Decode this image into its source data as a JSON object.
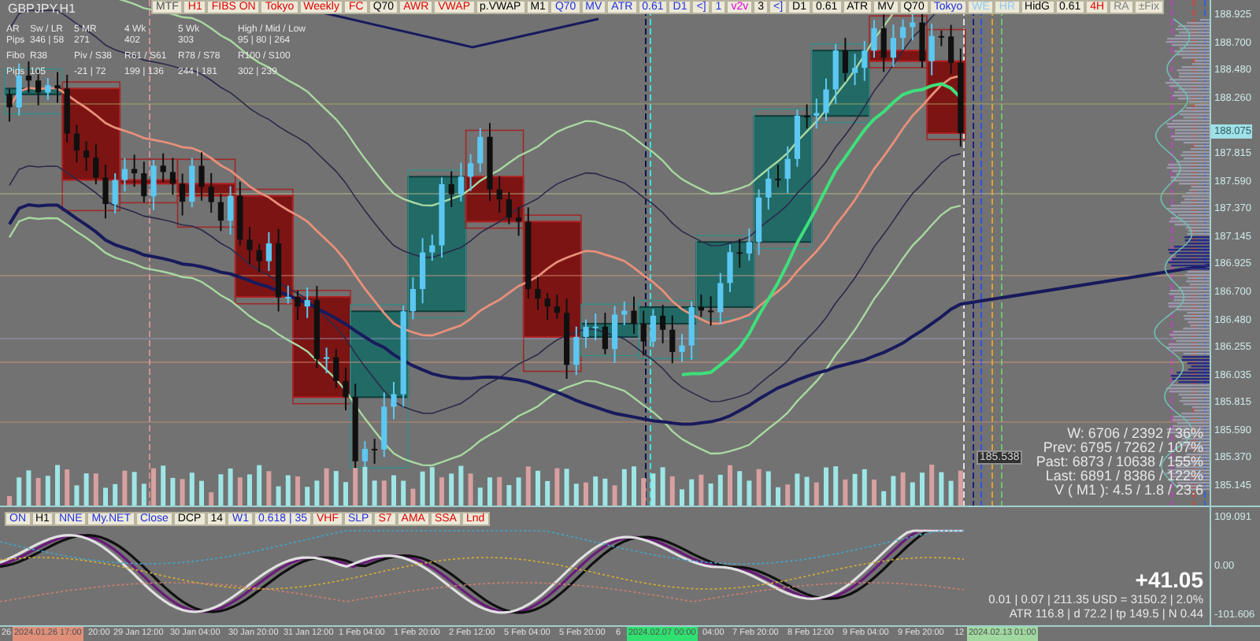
{
  "chart_title": "GBPJPY,H1",
  "top_toolbar": [
    {
      "label": "MTF",
      "color": "#505050"
    },
    {
      "label": "H1",
      "color": "#e00000"
    },
    {
      "label": "FIBS ON",
      "color": "#e00000"
    },
    {
      "label": "Tokyo",
      "color": "#e00000"
    },
    {
      "label": "Weekly",
      "color": "#e00000"
    },
    {
      "label": "FC",
      "color": "#e00000"
    },
    {
      "label": "Q70",
      "color": "#000000"
    },
    {
      "label": "AWR",
      "color": "#e00000"
    },
    {
      "label": "VWAP",
      "color": "#e00000"
    },
    {
      "label": "p.VWAP",
      "color": "#000000"
    },
    {
      "label": "M1",
      "color": "#000000"
    },
    {
      "label": "Q70",
      "color": "#2030e0"
    },
    {
      "label": "MV",
      "color": "#2030e0"
    },
    {
      "label": "ATR",
      "color": "#2030e0"
    },
    {
      "label": "0.61",
      "color": "#2030e0"
    },
    {
      "label": "D1",
      "color": "#2030e0"
    },
    {
      "label": "<]",
      "color": "#2030e0"
    },
    {
      "label": "1",
      "color": "#2030e0"
    },
    {
      "label": "v2v",
      "color": "#e000e0"
    },
    {
      "label": "3",
      "color": "#000000"
    },
    {
      "label": "<]",
      "color": "#2030e0"
    },
    {
      "label": "D1",
      "color": "#000000"
    },
    {
      "label": "0.61",
      "color": "#000000"
    },
    {
      "label": "ATR",
      "color": "#000000"
    },
    {
      "label": "MV",
      "color": "#000000"
    },
    {
      "label": "Q70",
      "color": "#000000"
    },
    {
      "label": "Tokyo",
      "color": "#2030e0"
    },
    {
      "label": "WE",
      "color": "#90c8f0"
    },
    {
      "label": "HR",
      "color": "#90c8f0"
    },
    {
      "label": "HidG",
      "color": "#000000"
    },
    {
      "label": "0.61",
      "color": "#000000"
    },
    {
      "label": "4H",
      "color": "#e00000"
    },
    {
      "label": "RA",
      "color": "#808080"
    },
    {
      "label": "±Fix",
      "color": "#808080"
    }
  ],
  "info_panel": [
    [
      "AR",
      "Sw / LR",
      "5 MR",
      "4 Wk",
      "5 Wk",
      "High / Mid / Low"
    ],
    [
      "Pips",
      "346 | 58",
      "271",
      "402",
      "303",
      "95 | 80 | 264"
    ],
    [
      "Fibo",
      "R38",
      "Piv / S38",
      "R61 / S61",
      "R78 / S78",
      "R100 / S100"
    ],
    [
      "Pips",
      "105",
      "-21 | 72",
      "199 | 136",
      "244 | 181",
      "302 | 239"
    ]
  ],
  "price_axis": [
    "188.925",
    "188.700",
    "188.480",
    "188.260",
    "187.815",
    "187.590",
    "187.370",
    "187.145",
    "186.925",
    "186.700",
    "186.480",
    "186.255",
    "186.035",
    "185.815",
    "185.590",
    "185.370",
    "185.145"
  ],
  "current_price": "188.075",
  "price_marker": "185.538",
  "volume_stats": [
    "W: 6706 / 2392 / 36%",
    "Prev: 6795 / 7262 / 107%",
    "Past: 6873 / 10638 / 155%",
    "Last: 6891 / 8386 / 122%",
    "V ( M1 ): 4.5 / 1.8 / 23.6"
  ],
  "indicator_toolbar": [
    {
      "label": "ON",
      "color": "#2030e0"
    },
    {
      "label": "H1",
      "color": "#000000"
    },
    {
      "label": "NNE",
      "color": "#2030e0"
    },
    {
      "label": "My.NET",
      "color": "#2030e0"
    },
    {
      "label": "Close",
      "color": "#2030e0"
    },
    {
      "label": "DCP",
      "color": "#000000"
    },
    {
      "label": "14",
      "color": "#000000"
    },
    {
      "label": "W1",
      "color": "#2030e0"
    },
    {
      "label": "0.618 | 35",
      "color": "#2030e0"
    },
    {
      "label": "VHF",
      "color": "#e00000"
    },
    {
      "label": "SLP",
      "color": "#2030e0"
    },
    {
      "label": "S7",
      "color": "#e00000"
    },
    {
      "label": "AMA",
      "color": "#e00000"
    },
    {
      "label": "SSA",
      "color": "#e00000"
    },
    {
      "label": "Lnd",
      "color": "#e00000"
    }
  ],
  "oscillator_axis": [
    "109.091",
    "0.00",
    "-101.606"
  ],
  "trade_panel": {
    "pnl": "+41.05",
    "lines": [
      "0.01 | 0.07 | 211.35 USD = 3150.2 | 2.0%",
      "ATR 116.8 | d 72.2 | tp 149.5 | N 0.44"
    ]
  },
  "time_axis": [
    {
      "label": "26",
      "kind": "plain"
    },
    {
      "label": "2024.01.26 17:00",
      "kind": "marker",
      "color": "#e0907a"
    },
    {
      "label": "20:00",
      "kind": "plain"
    },
    {
      "label": "29 Jan 12:00",
      "kind": "plain"
    },
    {
      "label": "30 Jan 04:00",
      "kind": "plain"
    },
    {
      "label": "30 Jan 20:00",
      "kind": "plain"
    },
    {
      "label": "31 Jan 12:00",
      "kind": "plain"
    },
    {
      "label": "1 Feb 04:00",
      "kind": "plain"
    },
    {
      "label": "1 Feb 20:00",
      "kind": "plain"
    },
    {
      "label": "2 Feb 12:00",
      "kind": "plain"
    },
    {
      "label": "5 Feb 04:00",
      "kind": "plain"
    },
    {
      "label": "5 Feb 20:00",
      "kind": "plain"
    },
    {
      "label": "6",
      "kind": "plain"
    },
    {
      "label": "2024.02.07 00:00",
      "kind": "marker",
      "color": "#30e070"
    },
    {
      "label": "04:00",
      "kind": "plain"
    },
    {
      "label": "7 Feb 20:00",
      "kind": "plain"
    },
    {
      "label": "8 Feb 12:00",
      "kind": "plain"
    },
    {
      "label": "9 Feb 04:00",
      "kind": "plain"
    },
    {
      "label": "9 Feb 20:00",
      "kind": "plain"
    },
    {
      "label": "12",
      "kind": "plain"
    },
    {
      "label": "2024.02.13 01:00",
      "kind": "marker",
      "color": "#a0d8a0"
    }
  ]
}
